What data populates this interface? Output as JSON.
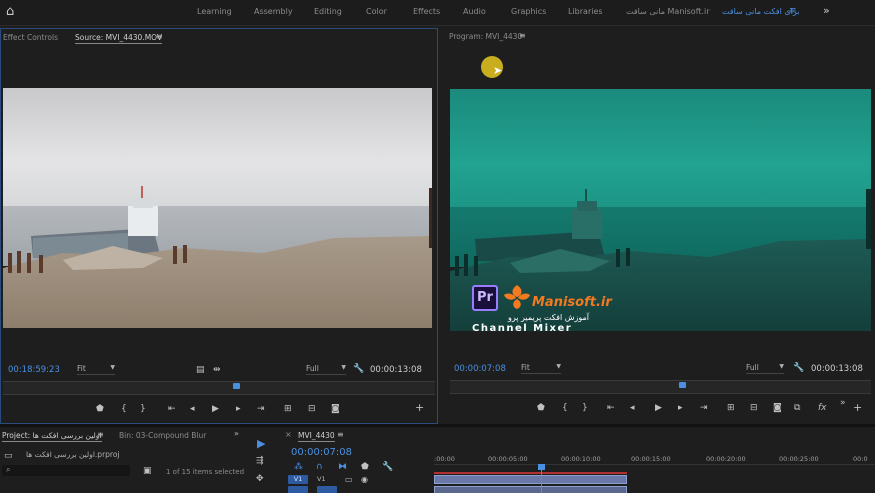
{
  "header": {
    "workspaces": [
      {
        "label": "Learning",
        "active": false
      },
      {
        "label": "Assembly",
        "active": false
      },
      {
        "label": "Editing",
        "active": false
      },
      {
        "label": "Color",
        "active": false
      },
      {
        "label": "Effects",
        "active": false
      },
      {
        "label": "Audio",
        "active": false
      },
      {
        "label": "Graphics",
        "active": false
      },
      {
        "label": "Libraries",
        "active": false
      },
      {
        "label": "مانی سافت Manisoft.ir",
        "active": false
      },
      {
        "label": "برای افکت مانی سافت",
        "active": true
      }
    ],
    "menu_icon": "hamburger-icon",
    "more_icon": "double-chevron-right-icon"
  },
  "source_monitor": {
    "tabs": [
      {
        "label": "Effect Controls",
        "active": false
      },
      {
        "label": "Source: MVI_4430.MOV",
        "active": true
      }
    ],
    "current_timecode": "00:18:59:23",
    "fit_label": "Fit",
    "quality_label": "Full",
    "duration": "00:00:13:08",
    "playhead_percent": 54
  },
  "program_monitor": {
    "tab_label": "Program: MVI_4430",
    "current_timecode": "00:00:07:08",
    "fit_label": "Fit",
    "quality_label": "Full",
    "duration": "00:00:13:08",
    "playhead_percent": 55,
    "overlay": {
      "logo_text": "Pr",
      "brand": "Manisoft.ir",
      "subtitle": "آموزش افکت پریمیر پرو",
      "title": "Channel Mixer"
    }
  },
  "project_panel": {
    "tab_label": "Project: اولین بررسی افکت ها",
    "bin_label": "Bin: 03-Compound Blur",
    "file_label": "اولین بررسی افکت ها.prproj",
    "selection_info": "1 of 15 items selected"
  },
  "timeline": {
    "tab_label": "MVI_4430",
    "timecode": "00:00:07:08",
    "ruler_labels": [
      ":00:00",
      "00:00:05:00",
      "00:00:10:00",
      "00:00:15:00",
      "00:00:20:00",
      "00:00:25:00",
      "00:0"
    ],
    "tracks": [
      "V1",
      "V1"
    ],
    "track_track_label": "V1"
  },
  "colors": {
    "accent": "#4a90e2",
    "panel_bg": "#1e1e1e",
    "program_tint": "#1a9c8a"
  }
}
